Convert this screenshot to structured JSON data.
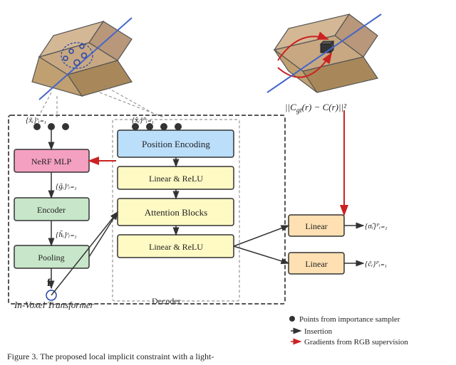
{
  "diagram": {
    "title": "In-Voxel Transformer",
    "decoder_label": "Decoder",
    "formula": "||C_gt(r) - C(r)||²",
    "caption": "Figure 3.   The proposed local implicit constraint with a light-",
    "boxes": {
      "nerf_mlp": "NeRF MLP",
      "encoder": "Encoder",
      "pooling": "Pooling",
      "position_encoding": "Position Encoding",
      "linear_relu_1": "Linear & ReLU",
      "attention_blocks": "Attention Blocks",
      "linear_relu_2": "Linear & ReLU",
      "linear_1": "Linear",
      "linear_2": "Linear"
    },
    "notations": {
      "input_left": "{x̃ᵢ}ˢᵢ₌₁",
      "input_mid": "{x̂ᵢ}ᴾᵢ₌₁",
      "g_tilde": "{g̃ᵢ}ˢᵢ₌₁",
      "h_tilde": "{h̃ᵢ}ˢᵢ₌₁",
      "f": "f",
      "sigma_hat": "{σ̂ᵢ}ᴾᵢ₌₁",
      "c_hat": "{ĉᵢ}ᴾᵢ₌₁"
    },
    "legend": {
      "dot": "Points from importance sampler",
      "black_arrow": "Insertion",
      "red_arrow": "Gradients from RGB supervision"
    }
  }
}
